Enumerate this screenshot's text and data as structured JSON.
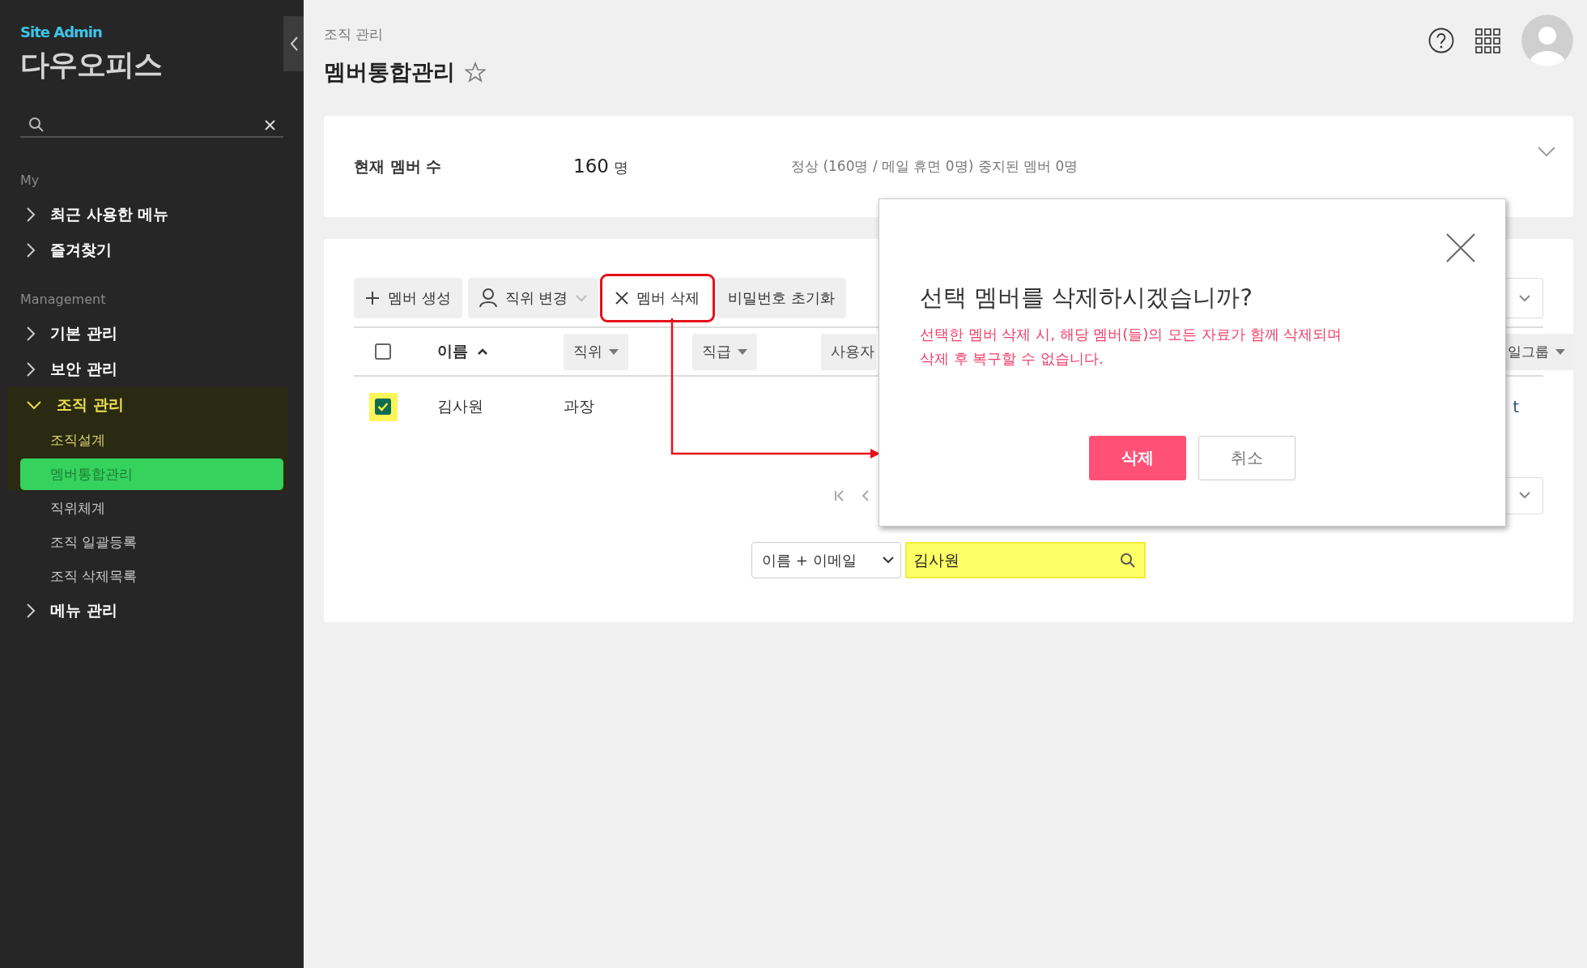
{
  "sidebar": {
    "brand_label": "Site Admin",
    "brand_name": "다우오피스",
    "sections": [
      {
        "heading": "My",
        "items": [
          {
            "label": "최근 사용한 메뉴",
            "expanded": false,
            "highlighted": false
          },
          {
            "label": "즐겨찾기",
            "expanded": false,
            "highlighted": false
          }
        ]
      },
      {
        "heading": "Management",
        "items": [
          {
            "label": "기본 관리",
            "expanded": false,
            "highlighted": false
          },
          {
            "label": "보안 관리",
            "expanded": false,
            "highlighted": false
          },
          {
            "label": "조직 관리",
            "expanded": true,
            "highlighted": true,
            "children": [
              {
                "label": "조직설계",
                "selected": false,
                "highlighted": true
              },
              {
                "label": "멤버통합관리",
                "selected": true,
                "highlighted": true
              },
              {
                "label": "직위체계",
                "selected": false,
                "highlighted": false
              },
              {
                "label": "조직 일괄등록",
                "selected": false,
                "highlighted": false
              },
              {
                "label": "조직 삭제목록",
                "selected": false,
                "highlighted": false
              }
            ]
          },
          {
            "label": "메뉴 관리",
            "expanded": false,
            "highlighted": false
          }
        ]
      }
    ]
  },
  "header": {
    "breadcrumb": "조직 관리",
    "title": "멤버통합관리",
    "favorite": false
  },
  "summary": {
    "label": "현재 멤버 수",
    "count": "160",
    "unit": "명",
    "detail": "정상 (160명 / 메일 휴면 0명) 중지된 멤버 0명"
  },
  "toolbar": [
    {
      "label": "멤버 생성",
      "kind": "create",
      "highlighted": false
    },
    {
      "label": "직위 변경",
      "kind": "position",
      "highlighted": false
    },
    {
      "label": "멤버 삭제",
      "kind": "delete",
      "highlighted": true
    },
    {
      "label": "비밀번호 초기화",
      "kind": "plain",
      "highlighted": false
    }
  ],
  "table": {
    "header_checked": false,
    "columns": [
      {
        "label": "이름",
        "kind": "sort"
      },
      {
        "label": "직위",
        "kind": "filter"
      },
      {
        "label": "직급",
        "kind": "filter"
      },
      {
        "label": "사용자",
        "kind": "plain"
      },
      {
        "label": "일그룹",
        "kind": "filter"
      }
    ],
    "rows": [
      {
        "checked": true,
        "highlighted": true,
        "cells": [
          "김사원",
          "과장"
        ],
        "column_cut": "t"
      }
    ]
  },
  "search": {
    "scope": "이름 + 이메일",
    "value": "김사원",
    "highlighted": true
  },
  "dialog": {
    "title": "선택 멤버를 삭제하시겠습니까?",
    "message": "선택한 멤버 삭제 시, 해당 멤버(들)의 모든 자료가 함께 삭제되며\n삭제 후 복구할 수 없습니다.",
    "buttons": [
      {
        "label": "삭제",
        "kind": "primary"
      },
      {
        "label": "취소",
        "kind": "secondary"
      }
    ]
  }
}
